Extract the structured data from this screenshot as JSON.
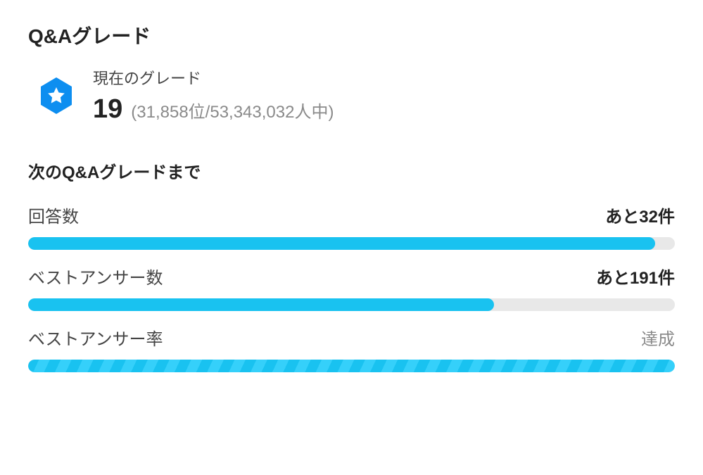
{
  "section_title": "Q&Aグレード",
  "current_grade": {
    "label": "現在のグレード",
    "value": "19",
    "rank": "(31,858位/53,343,032人中)"
  },
  "next_grade_title": "次のQ&Aグレードまで",
  "progress_items": [
    {
      "label": "回答数",
      "status": "あと32件",
      "achieved": false,
      "percent": 97
    },
    {
      "label": "ベストアンサー数",
      "status": "あと191件",
      "achieved": false,
      "percent": 72
    },
    {
      "label": "ベストアンサー率",
      "status": "達成",
      "achieved": true,
      "percent": 100
    }
  ],
  "colors": {
    "accent": "#19c2f0",
    "badge": "#0d8ef0"
  }
}
